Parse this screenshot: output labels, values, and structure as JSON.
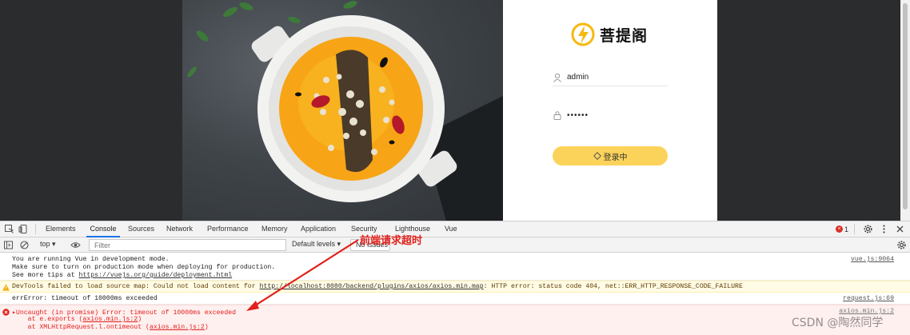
{
  "login": {
    "brand_name": "菩提阁",
    "username_value": "admin",
    "password_value": "••••••",
    "button_label": "登录中"
  },
  "devtools": {
    "tabs": [
      "Elements",
      "Console",
      "Sources",
      "Network",
      "Performance",
      "Memory",
      "Application",
      "Security",
      "Lighthouse",
      "Vue"
    ],
    "active_tab": "Console",
    "error_count": "1",
    "context": "top ▾",
    "filter_placeholder": "Filter",
    "levels": "Default levels ▾",
    "issues": "No Issues"
  },
  "console": {
    "vue_line1": "You are running Vue in development mode.",
    "vue_line2": "Make sure to turn on production mode when deploying for production.",
    "vue_line3_prefix": "See more tips at ",
    "vue_line3_link": "https://vuejs.org/guide/deployment.html",
    "vue_src": "vue.js:9064",
    "warn_prefix": "DevTools failed to load source map: Could not load content for ",
    "warn_link": "http://localhost:8080/backend/plugins/axios/axios.min.map",
    "warn_suffix": ": HTTP error: status code 404, net::ERR_HTTP_RESPONSE_CODE_FAILURE",
    "err1_text": "errError: timeout of 10000ms exceeded",
    "err1_src": "request.js:69",
    "err2_text": "▸Uncaught (in promise) Error: timeout of 10000ms exceeded",
    "err2_src": "axios.min.js:2",
    "err2_stack1_prefix": "    at e.exports (",
    "err2_stack1_link": "axios.min.js:2",
    "err2_stack2_prefix": "    at XMLHttpRequest.l.ontimeout (",
    "err2_stack2_link": "axios.min.js:2",
    "close_paren": ")"
  },
  "annotation": {
    "label": "前端请求超时",
    "color": "#e0201b"
  },
  "watermark": "CSDN @陶然同学",
  "colors": {
    "login_button": "#fcd35a",
    "logo_accent": "#f5b90f",
    "active_tab": "#1a73e8",
    "error_red": "#e0201b"
  }
}
